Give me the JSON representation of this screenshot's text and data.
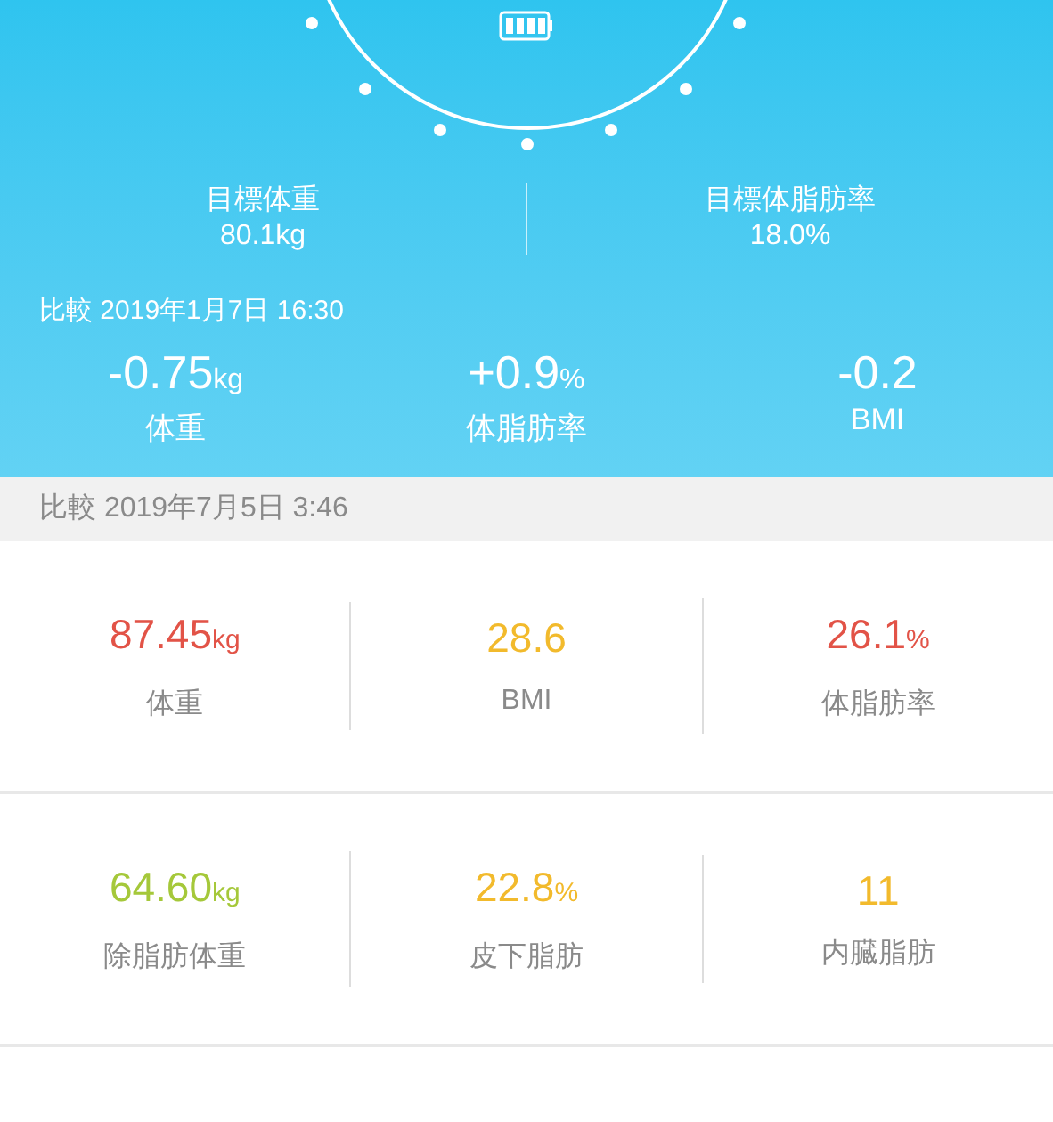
{
  "targets": [
    {
      "label": "目標体重",
      "value": "80.1kg"
    },
    {
      "label": "目標体脂肪率",
      "value": "18.0%"
    }
  ],
  "compare_header": "比較 2019年1月7日 16:30",
  "deltas": [
    {
      "value": "-0.75",
      "unit": "kg",
      "label": "体重"
    },
    {
      "value": "+0.9",
      "unit": "%",
      "label": "体脂肪率"
    },
    {
      "value": "-0.2",
      "label": "BMI"
    }
  ],
  "compare_bar": "比較 2019年7月5日 3:46",
  "metric_rows": [
    [
      {
        "value": "87.45",
        "unit": "kg",
        "label": "体重",
        "color": "#e25347"
      },
      {
        "value": "28.6",
        "label": "BMI",
        "color": "#f2ba2c"
      },
      {
        "value": "26.1",
        "unit": "%",
        "label": "体脂肪率",
        "color": "#e25347"
      }
    ],
    [
      {
        "value": "64.60",
        "unit": "kg",
        "label": "除脂肪体重",
        "color": "#a5c83a"
      },
      {
        "value": "22.8",
        "unit": "%",
        "label": "皮下脂肪",
        "color": "#f2ba2c"
      },
      {
        "value": "11",
        "label": "内臓脂肪",
        "color": "#f2ba2c"
      }
    ]
  ]
}
